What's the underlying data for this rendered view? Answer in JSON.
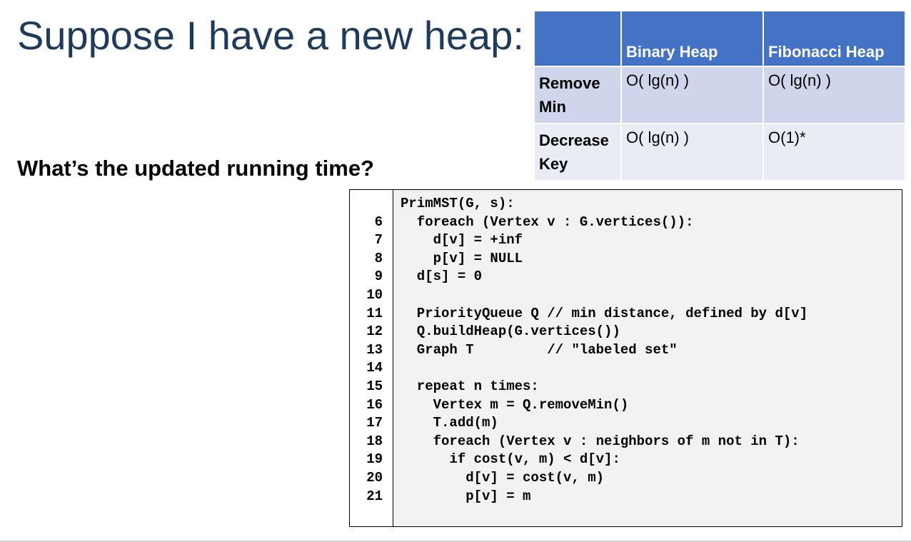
{
  "title": "Suppose I have a new heap:",
  "subtitle": "What’s the updated running time?",
  "table": {
    "headers": [
      "",
      "Binary Heap",
      "Fibonacci Heap"
    ],
    "rows": [
      {
        "label": "Remove Min",
        "binary": "O( lg(n) )",
        "fibonacci": "O( lg(n) )"
      },
      {
        "label": "Decrease Key",
        "binary": "O( lg(n) )",
        "fibonacci": "O(1)*"
      }
    ],
    "colors": {
      "header": "#4472c4",
      "row1": "#cfd5ea",
      "row2": "#e9ebf5"
    }
  },
  "code": {
    "lines": [
      {
        "num": "",
        "text": "PrimMST(G, s):"
      },
      {
        "num": "6",
        "text": "  foreach (Vertex v : G.vertices()):"
      },
      {
        "num": "7",
        "text": "    d[v] = +inf"
      },
      {
        "num": "8",
        "text": "    p[v] = NULL"
      },
      {
        "num": "9",
        "text": "  d[s] = 0"
      },
      {
        "num": "10",
        "text": ""
      },
      {
        "num": "11",
        "text": "  PriorityQueue Q // min distance, defined by d[v]"
      },
      {
        "num": "12",
        "text": "  Q.buildHeap(G.vertices())"
      },
      {
        "num": "13",
        "text": "  Graph T         // \"labeled set\""
      },
      {
        "num": "14",
        "text": ""
      },
      {
        "num": "15",
        "text": "  repeat n times:"
      },
      {
        "num": "16",
        "text": "    Vertex m = Q.removeMin()"
      },
      {
        "num": "17",
        "text": "    T.add(m)"
      },
      {
        "num": "18",
        "text": "    foreach (Vertex v : neighbors of m not in T):"
      },
      {
        "num": "19",
        "text": "      if cost(v, m) < d[v]:"
      },
      {
        "num": "20",
        "text": "        d[v] = cost(v, m)"
      },
      {
        "num": "21",
        "text": "        p[v] = m"
      }
    ]
  }
}
